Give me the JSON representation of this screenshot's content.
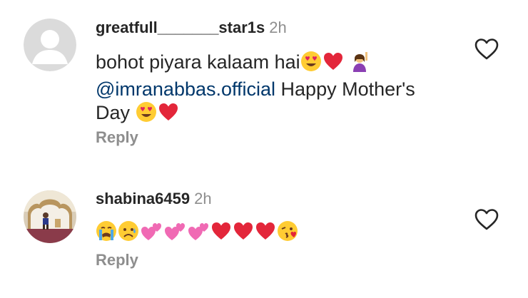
{
  "comments": [
    {
      "username": "greatfull_______star1s",
      "time": "2h",
      "text_line1": "bohot piyara kalaam hai",
      "mention": "@imranabbas.official",
      "text_line2_rest": " Happy Mother's",
      "text_line3": "Day ",
      "reply_label": "Reply",
      "avatar_type": "default-avatar",
      "emojis_line1": [
        "heart-eyes",
        "red-heart",
        "raising-hand"
      ],
      "emojis_line3": [
        "heart-eyes",
        "red-heart"
      ]
    },
    {
      "username": "shabina6459",
      "time": "2h",
      "reply_label": "Reply",
      "avatar_type": "photo-avatar",
      "emojis": [
        "crying",
        "sad",
        "two-hearts",
        "two-hearts",
        "two-hearts",
        "red-heart",
        "red-heart",
        "red-heart",
        "blowing-kiss"
      ]
    }
  ],
  "colors": {
    "text": "#262626",
    "secondary": "#8e8e8e",
    "mention": "#00376b",
    "heart": "#ed4956"
  }
}
